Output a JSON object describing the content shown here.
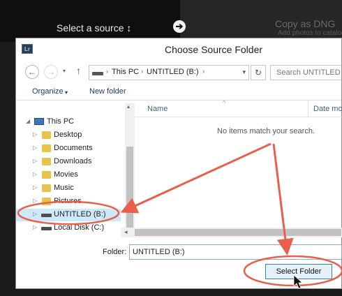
{
  "lightroom": {
    "source_label": "Select a source ↕",
    "arrow_glyph": "➔",
    "copy_mode": "Copy as DNG",
    "copy_subtitle": "Add photos to catalog"
  },
  "dialog": {
    "app_badge": "Lr",
    "title": "Choose Source Folder",
    "nav": {
      "back_glyph": "←",
      "forward_glyph": "→",
      "up_glyph": "↑",
      "refresh_glyph": "↻",
      "dropdown_glyph": "▾"
    },
    "breadcrumbs": [
      "This PC",
      "UNTITLED (B:)"
    ],
    "crumb_separator": "›",
    "search_placeholder": "Search UNTITLED (B:)",
    "commands": {
      "organize": "Organize",
      "organize_caret": "▾",
      "new_folder": "New folder"
    },
    "tree": [
      {
        "label": "This PC",
        "arrow": "◢",
        "icon": "pc-icon"
      },
      {
        "label": "Desktop",
        "arrow": "▷",
        "icon": "folder-icon"
      },
      {
        "label": "Documents",
        "arrow": "▷",
        "icon": "folder-icon"
      },
      {
        "label": "Downloads",
        "arrow": "▷",
        "icon": "folder-icon"
      },
      {
        "label": "Movies",
        "arrow": "▷",
        "icon": "folder-icon"
      },
      {
        "label": "Music",
        "arrow": "▷",
        "icon": "folder-icon"
      },
      {
        "label": "Pictures",
        "arrow": "▷",
        "icon": "folder-icon"
      },
      {
        "label": "UNTITLED (B:)",
        "arrow": "▷",
        "icon": "drive-icon",
        "selected": true
      },
      {
        "label": "Local Disk (C:)",
        "arrow": "▷",
        "icon": "drive-icon"
      }
    ],
    "columns": {
      "name": "Name",
      "date_modified": "Date modifie",
      "sort_caret": "^"
    },
    "empty_message": "No items match your search.",
    "scroll": {
      "up_glyph": "▴",
      "left_glyph": "◂"
    },
    "folder_field": {
      "label": "Folder:",
      "value": "UNTITLED (B:)"
    },
    "select_button": "Select Folder"
  },
  "annotation_colors": {
    "arrow": "#e8604c",
    "circle": "#e8604c"
  }
}
